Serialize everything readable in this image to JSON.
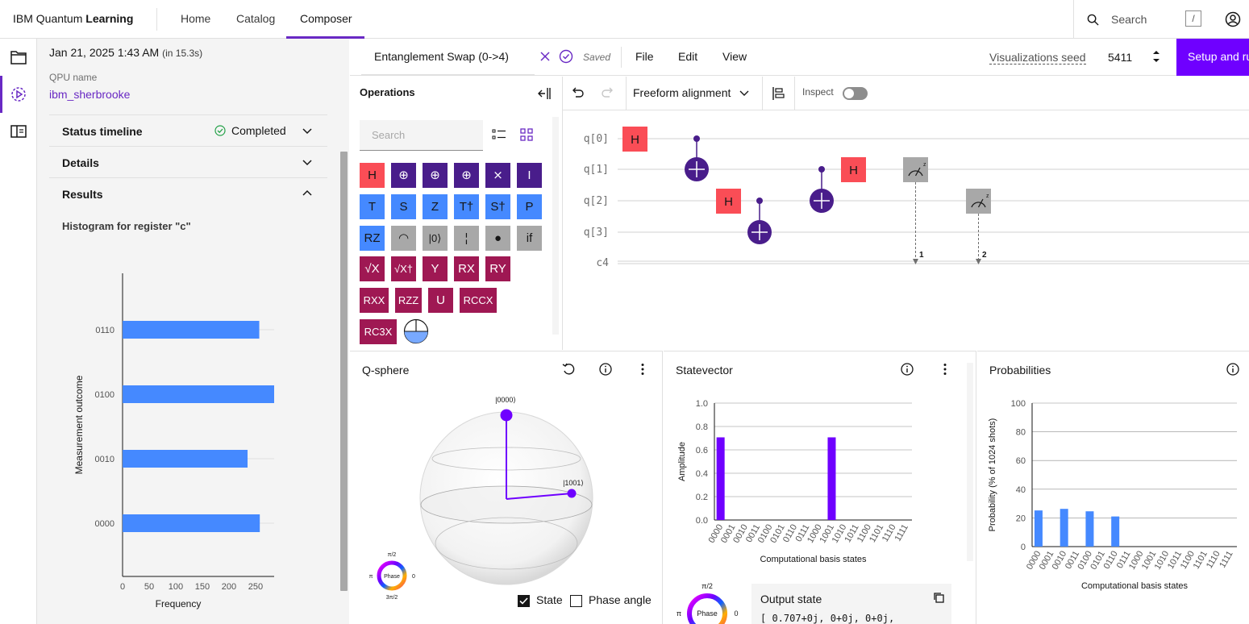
{
  "topbar": {
    "brand_prefix": "IBM Quantum",
    "brand_bold": "Learning",
    "nav": [
      "Home",
      "Catalog",
      "Composer"
    ],
    "search_placeholder": "Search",
    "search_shortcut": "/"
  },
  "job": {
    "date": "Jan 21, 2025 1:43 AM",
    "duration": "(in 15.3s)",
    "qpu_label": "QPU name",
    "qpu_name": "ibm_sherbrooke",
    "status_timeline_label": "Status timeline",
    "status_value": "Completed",
    "details_label": "Details",
    "results_label": "Results",
    "histogram_title": "Histogram for register \"c\""
  },
  "histogram": {
    "ylabel": "Measurement outcome",
    "xlabel": "Frequency",
    "categories": [
      "0000",
      "0010",
      "0100",
      "0110"
    ],
    "values": [
      258,
      235,
      285,
      257
    ],
    "xticks": [
      0,
      50,
      100,
      150,
      200,
      250
    ]
  },
  "circuit_header": {
    "file_name": "Entanglement Swap (0->4)",
    "saved_label": "Saved",
    "menus": [
      "File",
      "Edit",
      "View"
    ],
    "seed_label": "Visualizations seed",
    "seed_value": "5411",
    "setup_button": "Setup and ru"
  },
  "operations": {
    "title": "Operations",
    "search_placeholder": "Search",
    "rows": [
      [
        {
          "t": "H",
          "c": "red"
        },
        {
          "t": "⊕",
          "c": "purple"
        },
        {
          "t": "⊕",
          "c": "purple"
        },
        {
          "t": "⊕",
          "c": "purple"
        },
        {
          "t": "⨯",
          "c": "purple"
        },
        {
          "t": "I",
          "c": "purple"
        }
      ],
      [
        {
          "t": "T",
          "c": "blue"
        },
        {
          "t": "S",
          "c": "blue"
        },
        {
          "t": "Z",
          "c": "blue"
        },
        {
          "t": "T†",
          "c": "blue"
        },
        {
          "t": "S†",
          "c": "blue"
        },
        {
          "t": "P",
          "c": "blue"
        }
      ],
      [
        {
          "t": "RZ",
          "c": "blue"
        },
        {
          "t": "◠",
          "c": "gray"
        },
        {
          "t": "|0⟩",
          "c": "gray"
        },
        {
          "t": "¦",
          "c": "gray"
        },
        {
          "t": "●",
          "c": "gray"
        },
        {
          "t": "if",
          "c": "gray"
        }
      ],
      [
        {
          "t": "√X",
          "c": "mag"
        },
        {
          "t": "√X†",
          "c": "mag"
        },
        {
          "t": "Y",
          "c": "mag"
        },
        {
          "t": "RX",
          "c": "mag"
        },
        {
          "t": "RY",
          "c": "mag"
        }
      ],
      [
        {
          "t": "RXX",
          "c": "mag"
        },
        {
          "t": "RZZ",
          "c": "mag"
        },
        {
          "t": "U",
          "c": "mag"
        },
        {
          "t": "RCCX",
          "c": "mag"
        }
      ],
      [
        {
          "t": "RC3X",
          "c": "mag"
        }
      ]
    ]
  },
  "circuit_toolbar": {
    "alignment": "Freeform alignment",
    "inspect_label": "Inspect"
  },
  "circuit": {
    "qubits": [
      "q[0]",
      "q[1]",
      "q[2]",
      "q[3]"
    ],
    "classical": "c4",
    "gate_h": "H",
    "measure_bits": [
      "1",
      "2"
    ]
  },
  "qsphere": {
    "title": "Q-sphere",
    "state_a": "|0000⟩",
    "state_b": "|1001⟩",
    "phase_label": "Phase",
    "phase_top": "π/2",
    "phase_left": "π",
    "phase_right": "0",
    "phase_bottom": "3π/2",
    "state_checkbox": "State",
    "phase_checkbox": "Phase angle"
  },
  "statevector": {
    "title": "Statevector",
    "ylabel": "Amplitude",
    "xlabel": "Computational basis states",
    "output_title": "Output state",
    "output_text": "[ 0.707+0j, 0+0j, 0+0j,",
    "phase_label": "Phase",
    "phase_top": "π/2",
    "phase_left": "π",
    "phase_right": "0"
  },
  "probabilities": {
    "title": "Probabilities",
    "ylabel": "Probability (% of 1024 shots)",
    "xlabel": "Computational basis states"
  },
  "chart_data": [
    {
      "type": "bar",
      "title": "Statevector",
      "xlabel": "Computational basis states",
      "ylabel": "Amplitude",
      "categories": [
        "0000",
        "0001",
        "0010",
        "0011",
        "0100",
        "0101",
        "0110",
        "0111",
        "1000",
        "1001",
        "1010",
        "1011",
        "1100",
        "1101",
        "1110",
        "1111"
      ],
      "values": [
        0.707,
        0,
        0,
        0,
        0,
        0,
        0,
        0,
        0,
        0.707,
        0,
        0,
        0,
        0,
        0,
        0
      ],
      "ylim": [
        0,
        1.0
      ],
      "yticks": [
        "0.0",
        "0.2",
        "0.4",
        "0.6",
        "0.8",
        "1.0"
      ]
    },
    {
      "type": "bar",
      "title": "Probabilities",
      "xlabel": "Computational basis states",
      "ylabel": "Probability (% of 1024 shots)",
      "categories": [
        "0000",
        "0001",
        "0010",
        "0011",
        "0100",
        "0101",
        "0110",
        "0111",
        "1000",
        "1001",
        "1010",
        "1011",
        "1100",
        "1101",
        "1110",
        "1111"
      ],
      "values": [
        25.2,
        0,
        26.3,
        0,
        24.6,
        0,
        21.0,
        0,
        0,
        0,
        0,
        0,
        0,
        0,
        0,
        0
      ],
      "ylim": [
        0,
        100
      ],
      "yticks": [
        "0",
        "20",
        "40",
        "60",
        "80",
        "100"
      ]
    }
  ],
  "colors": {
    "accent": "#6929c4",
    "primary_button": "#6f00ff",
    "bar_blue": "#4589ff",
    "statevector_bar": "#6f00ff"
  }
}
